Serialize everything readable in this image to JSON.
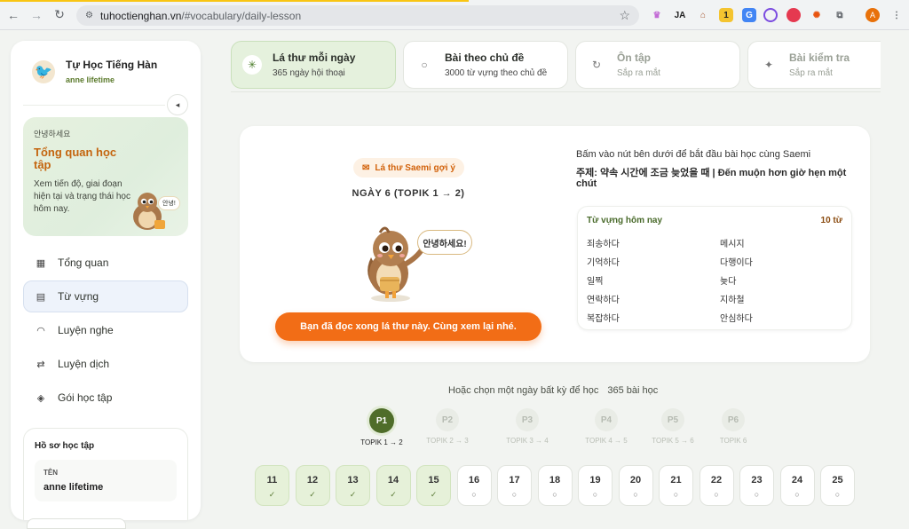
{
  "browser": {
    "url_host": "tuhoctienghan.vn",
    "url_path": "/#vocabulary/daily-lesson",
    "profile_initial": "A",
    "extensions": [
      "crown-ext",
      "JA",
      "house-ext",
      "badge-ext",
      "translate-ext",
      "ring-ext",
      "red-ext",
      "spark-ext",
      "puzzle-ext"
    ]
  },
  "sidebar": {
    "app_title": "Tự Học Tiếng Hàn",
    "app_subtitle": "anne lifetime",
    "overview": {
      "greeting": "안녕하세요",
      "title": "Tổng quan học tập",
      "description": "Xem tiến độ, giai đoạn hiện tại và trạng thái học hôm nay.",
      "bubble": "안녕!"
    },
    "menu": [
      {
        "label": "Tổng quan",
        "icon": "grid-icon"
      },
      {
        "label": "Từ vựng",
        "icon": "book-icon",
        "active": true
      },
      {
        "label": "Luyện nghe",
        "icon": "headphones-icon"
      },
      {
        "label": "Luyện dịch",
        "icon": "swap-icon"
      },
      {
        "label": "Gói học tập",
        "icon": "diamond-icon"
      }
    ],
    "profile": {
      "title": "Hồ sơ học tập",
      "name_label": "TÊN",
      "name_value": "anne lifetime"
    }
  },
  "tabs": [
    {
      "label": "Lá thư mỗi ngày",
      "sub": "365 ngày hội thoại",
      "icon": "sun-icon",
      "state": "active"
    },
    {
      "label": "Bài theo chủ đề",
      "sub": "3000 từ vựng theo chủ đề",
      "icon": "circle-icon",
      "state": "normal"
    },
    {
      "label": "Ôn tập",
      "sub": "Sắp ra mắt",
      "icon": "refresh-icon",
      "state": "muted"
    },
    {
      "label": "Bài kiểm tra",
      "sub": "Sắp ra mắt",
      "icon": "sparkle-icon",
      "state": "muted"
    }
  ],
  "lesson": {
    "tip": "Lá thư Saemi gợi ý",
    "day_title": "NGÀY 6 (TOPIK 1 → 2)",
    "bubble": "안녕하세요!",
    "button": "Bạn đã đọc xong lá thư này. Cùng xem lại nhé.",
    "instruction": "Bấm vào nút bên dưới để bắt đầu bài học cùng Saemi",
    "topic": "주제: 약속 시간에 조금 늦었을 때 | Đến muộn hơn giờ hẹn một chút",
    "vocab_title": "Từ vựng hôm nay",
    "vocab_count": "10 từ",
    "vocab": [
      "죄송하다",
      "메시지",
      "기억하다",
      "다행이다",
      "일찍",
      "늦다",
      "연락하다",
      "지하철",
      "복잡하다",
      "안심하다"
    ]
  },
  "picker": {
    "prompt": "Hoặc chọn một ngày bất kỳ để học",
    "count": "365 bài học",
    "levels": [
      {
        "code": "P1",
        "name": "TOPIK 1 → 2",
        "active": true
      },
      {
        "code": "P2",
        "name": "TOPIK 2 → 3"
      },
      {
        "code": "P3",
        "name": "TOPIK 3 → 4"
      },
      {
        "code": "P4",
        "name": "TOPIK 4 → 5"
      },
      {
        "code": "P5",
        "name": "TOPIK 5 → 6"
      },
      {
        "code": "P6",
        "name": "TOPIK 6"
      }
    ],
    "days": [
      {
        "n": "11",
        "done": true
      },
      {
        "n": "12",
        "done": true
      },
      {
        "n": "13",
        "done": true
      },
      {
        "n": "14",
        "done": true
      },
      {
        "n": "15",
        "done": true
      },
      {
        "n": "16",
        "done": false
      },
      {
        "n": "17",
        "done": false
      },
      {
        "n": "18",
        "done": false
      },
      {
        "n": "19",
        "done": false
      },
      {
        "n": "20",
        "done": false
      },
      {
        "n": "21",
        "done": false
      },
      {
        "n": "22",
        "done": false
      },
      {
        "n": "23",
        "done": false
      },
      {
        "n": "24",
        "done": false
      },
      {
        "n": "25",
        "done": false
      }
    ]
  },
  "colors": {
    "accent_orange": "#f26d16",
    "accent_green": "#4f6d2a",
    "active_tab": "#e5f1dd"
  }
}
